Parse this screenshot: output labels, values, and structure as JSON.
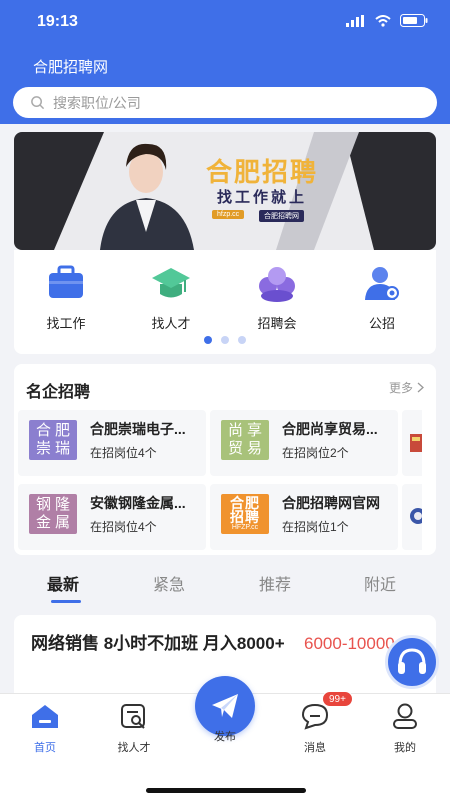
{
  "status_bar": {
    "time": "19:13"
  },
  "header": {
    "title": "合肥招聘网",
    "search_placeholder": "搜索职位/公司"
  },
  "banner": {
    "headline": "合肥招聘",
    "subline": "找工作就上",
    "site": "hfzp.cc",
    "brand": "合肥招聘网"
  },
  "quick_nav": [
    {
      "label": "找工作",
      "icon": "briefcase-icon"
    },
    {
      "label": "找人才",
      "icon": "graduation-cap-icon"
    },
    {
      "label": "招聘会",
      "icon": "group-icon"
    },
    {
      "label": "公招",
      "icon": "person-badge-icon"
    }
  ],
  "pagination": {
    "pages": 3,
    "active": 1
  },
  "famous": {
    "title": "名企招聘",
    "more_label": "更多",
    "companies": [
      {
        "logo": "合肥崇瑞",
        "logo_color": "#8b7fcf",
        "name": "合肥崇瑞电子...",
        "jobs": "在招岗位4个"
      },
      {
        "logo": "尚享贸易",
        "logo_color": "#a8c27a",
        "name": "合肥尚享贸易...",
        "jobs": "在招岗位2个"
      },
      {
        "logo": "钢隆金属",
        "logo_color": "#b07fa6",
        "name": "安徽钢隆金属...",
        "jobs": "在招岗位4个"
      },
      {
        "logo": "合肥招聘",
        "logo_sub": "HFZP.cc",
        "logo_color": "#f0932e",
        "name": "合肥招聘网官网",
        "jobs": "在招岗位1个"
      }
    ]
  },
  "tabs": [
    {
      "label": "最新",
      "active": true
    },
    {
      "label": "紧急",
      "active": false
    },
    {
      "label": "推荐",
      "active": false
    },
    {
      "label": "附近",
      "active": false
    }
  ],
  "job": {
    "title": "网络销售 8小时不加班 月入8000+",
    "salary": "6000-10000"
  },
  "tabbar": {
    "items": [
      {
        "label": "首页",
        "icon": "home-icon",
        "active": true
      },
      {
        "label": "找人才",
        "icon": "find-talent-icon",
        "active": false
      },
      {
        "label": "发布",
        "icon": "paper-plane-icon",
        "active": false
      },
      {
        "label": "消息",
        "icon": "message-icon",
        "active": false
      },
      {
        "label": "我的",
        "icon": "profile-icon",
        "active": false
      }
    ],
    "message_badge": "99+"
  },
  "colors": {
    "primary": "#3f6fe8",
    "salary": "#e8534e",
    "badge": "#e8453c"
  }
}
